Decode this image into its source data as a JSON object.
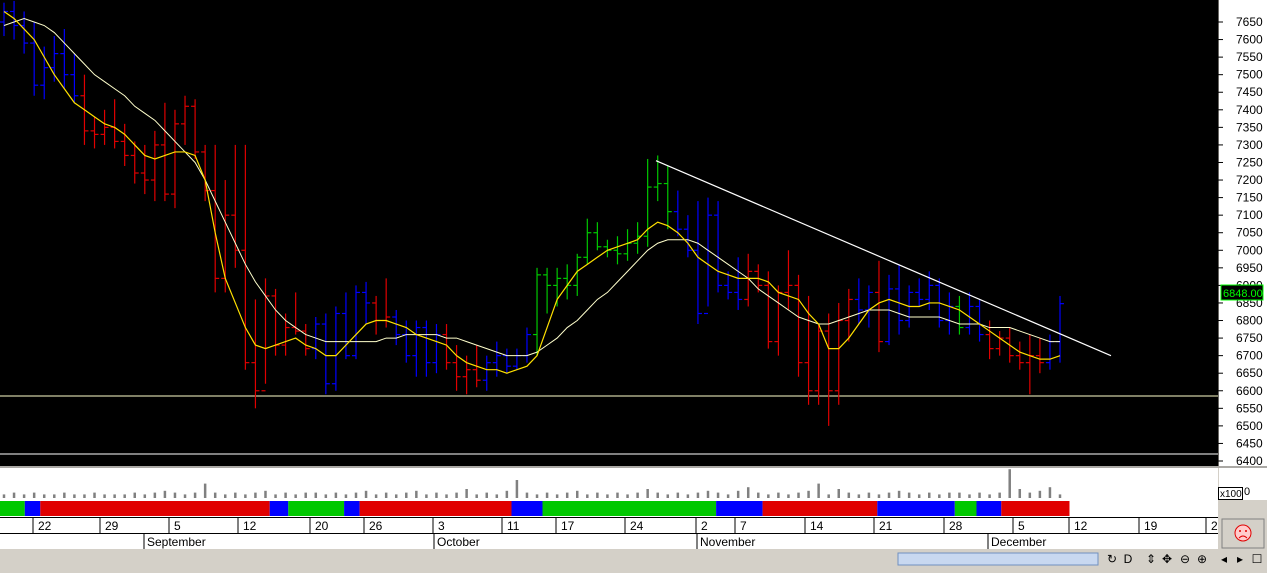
{
  "chart_data": {
    "type": "ohlc",
    "y_ticks": [
      6400,
      6450,
      6500,
      6550,
      6600,
      6650,
      6700,
      6750,
      6800,
      6850,
      6900,
      6950,
      7000,
      7050,
      7100,
      7150,
      7200,
      7250,
      7300,
      7350,
      7400,
      7450,
      7500,
      7550,
      7600,
      7650
    ],
    "ylim": [
      6390,
      7710
    ],
    "current_price": "6848.00",
    "x_day_labels": [
      "22",
      "29",
      "5",
      "12",
      "20",
      "26",
      "3",
      "11",
      "17",
      "24",
      "2",
      "7",
      "14",
      "21",
      "28",
      "5",
      "12",
      "19",
      "2"
    ],
    "x_month_labels": [
      "September",
      "October",
      "November",
      "December"
    ],
    "volume_scale_label": "x100",
    "support_level": 6585,
    "lower_level": 6420,
    "trendline": {
      "from": [
        0,
        7255
      ],
      "to": [
        1,
        6700
      ]
    },
    "colors": {
      "up": "#00c800",
      "down": "#e00000",
      "neutral": "#0000ff",
      "ma_fast": "#ffe000",
      "ma_slow": "#ffffcc",
      "background": "#000000"
    },
    "bars": [
      [
        7650,
        7705,
        7610,
        7680,
        "b"
      ],
      [
        7680,
        7710,
        7600,
        7640,
        "b"
      ],
      [
        7640,
        7680,
        7560,
        7590,
        "b"
      ],
      [
        7590,
        7650,
        7440,
        7470,
        "b"
      ],
      [
        7470,
        7580,
        7430,
        7520,
        "b"
      ],
      [
        7520,
        7610,
        7480,
        7560,
        "b"
      ],
      [
        7560,
        7630,
        7460,
        7500,
        "b"
      ],
      [
        7500,
        7560,
        7420,
        7440,
        "b"
      ],
      [
        7440,
        7500,
        7300,
        7340,
        "r"
      ],
      [
        7340,
        7380,
        7290,
        7330,
        "r"
      ],
      [
        7330,
        7400,
        7300,
        7350,
        "r"
      ],
      [
        7350,
        7430,
        7290,
        7310,
        "r"
      ],
      [
        7310,
        7360,
        7240,
        7270,
        "r"
      ],
      [
        7270,
        7310,
        7190,
        7220,
        "r"
      ],
      [
        7220,
        7300,
        7160,
        7200,
        "r"
      ],
      [
        7200,
        7340,
        7140,
        7300,
        "r"
      ],
      [
        7300,
        7420,
        7140,
        7160,
        "r"
      ],
      [
        7160,
        7400,
        7120,
        7360,
        "r"
      ],
      [
        7360,
        7440,
        7300,
        7410,
        "r"
      ],
      [
        7410,
        7430,
        7260,
        7280,
        "r"
      ],
      [
        7280,
        7300,
        7140,
        7170,
        "r"
      ],
      [
        7170,
        7300,
        6880,
        6920,
        "r"
      ],
      [
        6920,
        7200,
        6880,
        7100,
        "r"
      ],
      [
        7100,
        7300,
        6950,
        7000,
        "r"
      ],
      [
        7000,
        7300,
        6660,
        6680,
        "r"
      ],
      [
        6680,
        6860,
        6550,
        6600,
        "r"
      ],
      [
        6600,
        6920,
        6620,
        6870,
        "r"
      ],
      [
        6870,
        6890,
        6700,
        6730,
        "r"
      ],
      [
        6730,
        6820,
        6700,
        6780,
        "r"
      ],
      [
        6780,
        6880,
        6760,
        6770,
        "r"
      ],
      [
        6770,
        6790,
        6700,
        6720,
        "r"
      ],
      [
        6720,
        6810,
        6690,
        6790,
        "b"
      ],
      [
        6790,
        6820,
        6590,
        6620,
        "b"
      ],
      [
        6620,
        6840,
        6600,
        6820,
        "b"
      ],
      [
        6820,
        6880,
        6690,
        6700,
        "b"
      ],
      [
        6700,
        6900,
        6690,
        6880,
        "b"
      ],
      [
        6880,
        6910,
        6790,
        6850,
        "b"
      ],
      [
        6850,
        6870,
        6760,
        6800,
        "r"
      ],
      [
        6800,
        6920,
        6780,
        6810,
        "r"
      ],
      [
        6810,
        6830,
        6730,
        6760,
        "b"
      ],
      [
        6760,
        6800,
        6680,
        6700,
        "b"
      ],
      [
        6700,
        6800,
        6640,
        6780,
        "b"
      ],
      [
        6780,
        6800,
        6640,
        6680,
        "b"
      ],
      [
        6680,
        6790,
        6650,
        6760,
        "b"
      ],
      [
        6760,
        6790,
        6660,
        6680,
        "r"
      ],
      [
        6680,
        6730,
        6600,
        6640,
        "r"
      ],
      [
        6640,
        6700,
        6590,
        6660,
        "r"
      ],
      [
        6660,
        6730,
        6610,
        6630,
        "r"
      ],
      [
        6630,
        6700,
        6600,
        6680,
        "b"
      ],
      [
        6680,
        6740,
        6640,
        6700,
        "b"
      ],
      [
        6700,
        6720,
        6650,
        6670,
        "b"
      ],
      [
        6670,
        6720,
        6660,
        6700,
        "b"
      ],
      [
        6700,
        6780,
        6680,
        6760,
        "b"
      ],
      [
        6760,
        6950,
        6700,
        6930,
        "g"
      ],
      [
        6930,
        6950,
        6820,
        6900,
        "g"
      ],
      [
        6900,
        6950,
        6840,
        6920,
        "g"
      ],
      [
        6920,
        6960,
        6860,
        6900,
        "g"
      ],
      [
        6900,
        6990,
        6870,
        6980,
        "g"
      ],
      [
        6980,
        7090,
        6960,
        7050,
        "g"
      ],
      [
        7050,
        7080,
        7000,
        7010,
        "g"
      ],
      [
        7010,
        7030,
        6980,
        7000,
        "g"
      ],
      [
        7000,
        7040,
        6960,
        6990,
        "g"
      ],
      [
        6990,
        7060,
        6970,
        7020,
        "g"
      ],
      [
        7020,
        7080,
        6990,
        7040,
        "g"
      ],
      [
        7040,
        7260,
        7010,
        7180,
        "g"
      ],
      [
        7180,
        7270,
        7140,
        7190,
        "g"
      ],
      [
        7190,
        7240,
        7060,
        7110,
        "g"
      ],
      [
        7110,
        7170,
        7040,
        7060,
        "b"
      ],
      [
        7060,
        7100,
        6980,
        7000,
        "b"
      ],
      [
        7000,
        7140,
        6790,
        6820,
        "b"
      ],
      [
        6820,
        7150,
        6840,
        7100,
        "b"
      ],
      [
        7100,
        7140,
        6880,
        6900,
        "b"
      ],
      [
        6900,
        6940,
        6860,
        6880,
        "b"
      ],
      [
        6880,
        6980,
        6830,
        6860,
        "b"
      ],
      [
        6860,
        6990,
        6840,
        6940,
        "r"
      ],
      [
        6940,
        6960,
        6880,
        6900,
        "r"
      ],
      [
        6900,
        6940,
        6720,
        6740,
        "r"
      ],
      [
        6740,
        6900,
        6700,
        6880,
        "r"
      ],
      [
        6880,
        7000,
        6830,
        6900,
        "r"
      ],
      [
        6900,
        6930,
        6640,
        6680,
        "r"
      ],
      [
        6680,
        6870,
        6560,
        6600,
        "r"
      ],
      [
        6600,
        6790,
        6560,
        6770,
        "r"
      ],
      [
        6770,
        6820,
        6500,
        6600,
        "r"
      ],
      [
        6600,
        6850,
        6560,
        6800,
        "r"
      ],
      [
        6800,
        6890,
        6740,
        6860,
        "r"
      ],
      [
        6860,
        6920,
        6790,
        6830,
        "b"
      ],
      [
        6830,
        6900,
        6780,
        6880,
        "b"
      ],
      [
        6880,
        6970,
        6710,
        6740,
        "r"
      ],
      [
        6740,
        6930,
        6730,
        6890,
        "b"
      ],
      [
        6890,
        6960,
        6760,
        6800,
        "b"
      ],
      [
        6800,
        6900,
        6780,
        6880,
        "b"
      ],
      [
        6880,
        6920,
        6840,
        6860,
        "b"
      ],
      [
        6860,
        6940,
        6830,
        6900,
        "b"
      ],
      [
        6900,
        6920,
        6780,
        6800,
        "b"
      ],
      [
        6800,
        6880,
        6760,
        6840,
        "b"
      ],
      [
        6840,
        6870,
        6760,
        6780,
        "g"
      ],
      [
        6780,
        6880,
        6760,
        6840,
        "b"
      ],
      [
        6840,
        6860,
        6740,
        6760,
        "b"
      ],
      [
        6760,
        6800,
        6690,
        6720,
        "r"
      ],
      [
        6720,
        6770,
        6700,
        6750,
        "r"
      ],
      [
        6750,
        6780,
        6680,
        6700,
        "r"
      ],
      [
        6700,
        6740,
        6660,
        6680,
        "r"
      ],
      [
        6680,
        6760,
        6590,
        6700,
        "r"
      ],
      [
        6700,
        6750,
        6650,
        6680,
        "r"
      ],
      [
        6680,
        6760,
        6660,
        6740,
        "b"
      ],
      [
        6740,
        6870,
        6680,
        6848,
        "b"
      ]
    ],
    "ma_fast": [
      7680,
      7660,
      7630,
      7600,
      7550,
      7500,
      7460,
      7420,
      7400,
      7380,
      7360,
      7350,
      7330,
      7300,
      7270,
      7260,
      7270,
      7280,
      7280,
      7270,
      7200,
      7050,
      6920,
      6850,
      6780,
      6730,
      6720,
      6730,
      6740,
      6750,
      6730,
      6720,
      6700,
      6700,
      6730,
      6760,
      6790,
      6800,
      6800,
      6790,
      6780,
      6760,
      6750,
      6740,
      6730,
      6700,
      6680,
      6670,
      6660,
      6660,
      6650,
      6660,
      6670,
      6700,
      6780,
      6860,
      6900,
      6940,
      6960,
      6980,
      7000,
      7010,
      7020,
      7030,
      7060,
      7080,
      7070,
      7050,
      7020,
      6980,
      6960,
      6940,
      6930,
      6920,
      6920,
      6920,
      6910,
      6880,
      6870,
      6860,
      6820,
      6790,
      6720,
      6720,
      6750,
      6790,
      6830,
      6850,
      6860,
      6850,
      6840,
      6840,
      6850,
      6850,
      6840,
      6830,
      6810,
      6790,
      6770,
      6750,
      6730,
      6710,
      6700,
      6690,
      6690,
      6700
    ],
    "ma_slow": [
      7640,
      7650,
      7660,
      7650,
      7640,
      7620,
      7590,
      7560,
      7530,
      7500,
      7480,
      7460,
      7440,
      7410,
      7390,
      7370,
      7340,
      7310,
      7280,
      7250,
      7200,
      7140,
      7080,
      7020,
      6960,
      6910,
      6870,
      6830,
      6800,
      6780,
      6760,
      6750,
      6740,
      6740,
      6740,
      6740,
      6740,
      6740,
      6750,
      6750,
      6760,
      6760,
      6760,
      6760,
      6750,
      6750,
      6740,
      6730,
      6720,
      6710,
      6700,
      6700,
      6700,
      6710,
      6730,
      6750,
      6780,
      6800,
      6830,
      6860,
      6880,
      6910,
      6940,
      6970,
      7000,
      7020,
      7030,
      7030,
      7030,
      7020,
      7000,
      6980,
      6960,
      6940,
      6920,
      6890,
      6870,
      6850,
      6830,
      6810,
      6800,
      6790,
      6790,
      6800,
      6810,
      6820,
      6830,
      6830,
      6830,
      6820,
      6810,
      6810,
      6810,
      6810,
      6800,
      6790,
      6790,
      6790,
      6780,
      6780,
      6780,
      6770,
      6760,
      6750,
      6740,
      6740
    ],
    "volume": [
      2,
      3,
      2,
      3,
      2,
      2,
      3,
      2,
      2,
      3,
      2,
      2,
      2,
      3,
      2,
      3,
      4,
      3,
      2,
      3,
      8,
      3,
      2,
      3,
      2,
      3,
      4,
      2,
      3,
      2,
      3,
      3,
      2,
      3,
      2,
      3,
      4,
      2,
      3,
      2,
      3,
      4,
      2,
      3,
      2,
      3,
      5,
      2,
      3,
      2,
      4,
      10,
      3,
      2,
      3,
      2,
      3,
      4,
      2,
      3,
      2,
      3,
      2,
      3,
      5,
      3,
      2,
      3,
      2,
      3,
      4,
      3,
      2,
      4,
      6,
      3,
      2,
      3,
      2,
      3,
      4,
      8,
      2,
      5,
      3,
      2,
      3,
      2,
      3,
      4,
      3,
      2,
      3,
      2,
      3,
      3,
      2,
      3,
      2,
      3,
      16,
      5,
      3,
      4,
      6,
      2
    ],
    "signal_bands": [
      {
        "from": 0,
        "to": 8,
        "color": "g"
      },
      {
        "from": 8,
        "to": 13,
        "color": "b"
      },
      {
        "from": 13,
        "to": 87,
        "color": "r"
      },
      {
        "from": 87,
        "to": 93,
        "color": "b"
      },
      {
        "from": 93,
        "to": 111,
        "color": "g"
      },
      {
        "from": 111,
        "to": 116,
        "color": "b"
      },
      {
        "from": 116,
        "to": 165,
        "color": "r"
      },
      {
        "from": 165,
        "to": 175,
        "color": "b"
      },
      {
        "from": 175,
        "to": 231,
        "color": "g"
      },
      {
        "from": 231,
        "to": 246,
        "color": "b"
      },
      {
        "from": 246,
        "to": 283,
        "color": "r"
      },
      {
        "from": 283,
        "to": 308,
        "color": "b"
      },
      {
        "from": 308,
        "to": 315,
        "color": "g"
      },
      {
        "from": 315,
        "to": 323,
        "color": "b"
      },
      {
        "from": 323,
        "to": 345,
        "color": "r"
      }
    ]
  }
}
